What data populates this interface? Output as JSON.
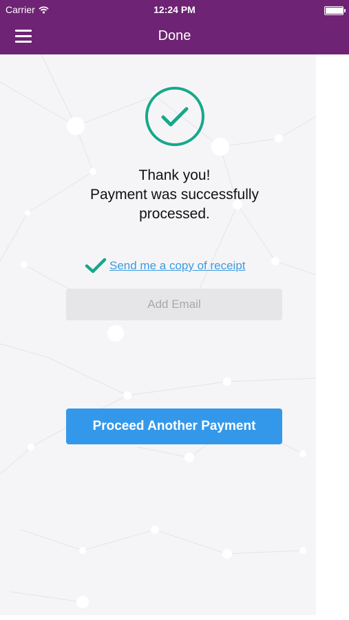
{
  "status_bar": {
    "carrier": "Carrier",
    "time": "12:24 PM",
    "battery_level": 0.95
  },
  "nav": {
    "title": "Done"
  },
  "success": {
    "line1": "Thank you!",
    "line2": "Payment was successfully",
    "line3": "processed."
  },
  "receipt": {
    "link_label": "Send me a copy of receipt"
  },
  "email": {
    "placeholder": "Add Email"
  },
  "actions": {
    "proceed_label": "Proceed Another Payment"
  },
  "colors": {
    "brand": "#6e2374",
    "success_green": "#16a88a",
    "action_blue": "#3498ea",
    "link_blue": "#3a9be2"
  }
}
